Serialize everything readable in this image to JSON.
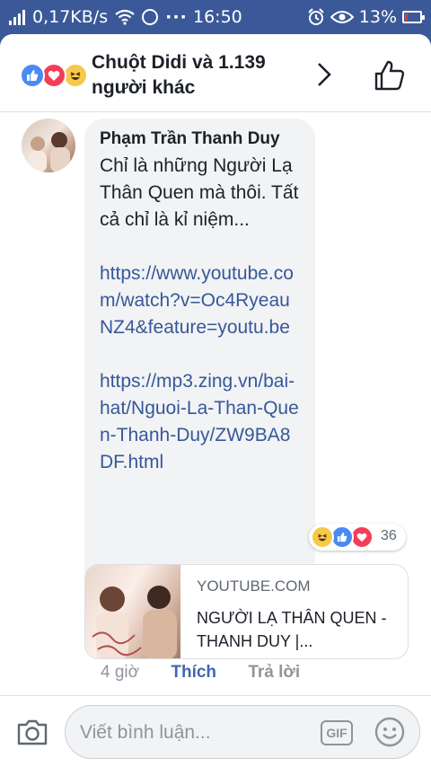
{
  "status_bar": {
    "network_speed": "0,17KB/s",
    "time": "16:50",
    "battery": "13%"
  },
  "header": {
    "title": "Chuột Didi và 1.139 người khác",
    "reaction_icons": [
      "like-icon",
      "love-icon",
      "haha-icon"
    ]
  },
  "comment": {
    "author": "Phạm Trần Thanh Duy",
    "text": "Chỉ là những Người Lạ Thân Quen mà thôi. Tất cả chỉ là kỉ niệm...",
    "link1": "https://www.youtube.com/watch?v=Oc4RyeauNZ4&feature=youtu.be",
    "link2": "https://mp3.zing.vn/bai-hat/Nguoi-La-Than-Quen-Thanh-Duy/ZW9BA8DF.html",
    "reaction_count": "36",
    "reaction_icons": [
      "haha-icon",
      "like-icon",
      "love-icon"
    ]
  },
  "link_preview": {
    "source": "YOUTUBE.COM",
    "title": "NGƯỜI LẠ THÂN QUEN - THANH DUY |..."
  },
  "comment_actions": {
    "time": "4 giờ",
    "like": "Thích",
    "reply": "Trả lời"
  },
  "composer": {
    "placeholder": "Viết bình luận...",
    "gif_label": "GIF"
  },
  "colors": {
    "brand_blue": "#3b5998",
    "link_blue": "#365899",
    "action_blue": "#4267b2",
    "love_red": "#f33e58",
    "haha_yellow": "#f7c948"
  }
}
